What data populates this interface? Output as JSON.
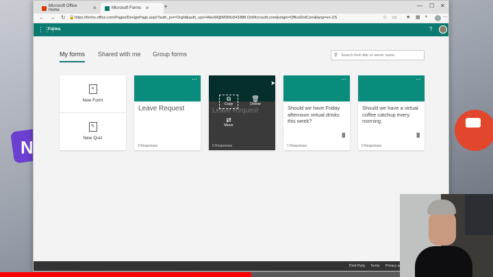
{
  "browser": {
    "tabs": [
      {
        "label": "Microsoft Office Home",
        "active": false,
        "favicon_color": "#d83b01"
      },
      {
        "label": "Microsoft Forms",
        "active": true,
        "favicon_color": "#0b7a70"
      }
    ],
    "url": "https://forms.office.com/Pages/DesignPage.aspx?auth_pvr=OrgId&auth_upn=AlexW@M365x541888.OnMicrosoft.com&origin=OfficeDotCom&lang=en-US"
  },
  "app": {
    "name": "Forms",
    "accent": "#0b7a70"
  },
  "tabs": [
    {
      "label": "My forms",
      "active": true
    },
    {
      "label": "Shared with me",
      "active": false
    },
    {
      "label": "Group forms",
      "active": false
    }
  ],
  "search": {
    "placeholder": "Search form title or owner name"
  },
  "new_items": {
    "form": "New Form",
    "quiz": "New Quiz"
  },
  "cards": [
    {
      "title": "Leave Request",
      "responses": "2 Responses"
    },
    {
      "title": "Leave Request",
      "responses": "0 Responses"
    },
    {
      "title": "Should we have Friday afternoon virtual drinks this week?",
      "responses": "1 Responses"
    },
    {
      "title": "Should we have a virtual coffee catchup every morning.",
      "responses": "0 Responses"
    }
  ],
  "hover_menu": {
    "copy": "Copy",
    "delete": "Delete",
    "move": "Move"
  },
  "footer": {
    "third_party": "Third Party",
    "terms": "Terms",
    "privacy": "Privacy an..."
  }
}
